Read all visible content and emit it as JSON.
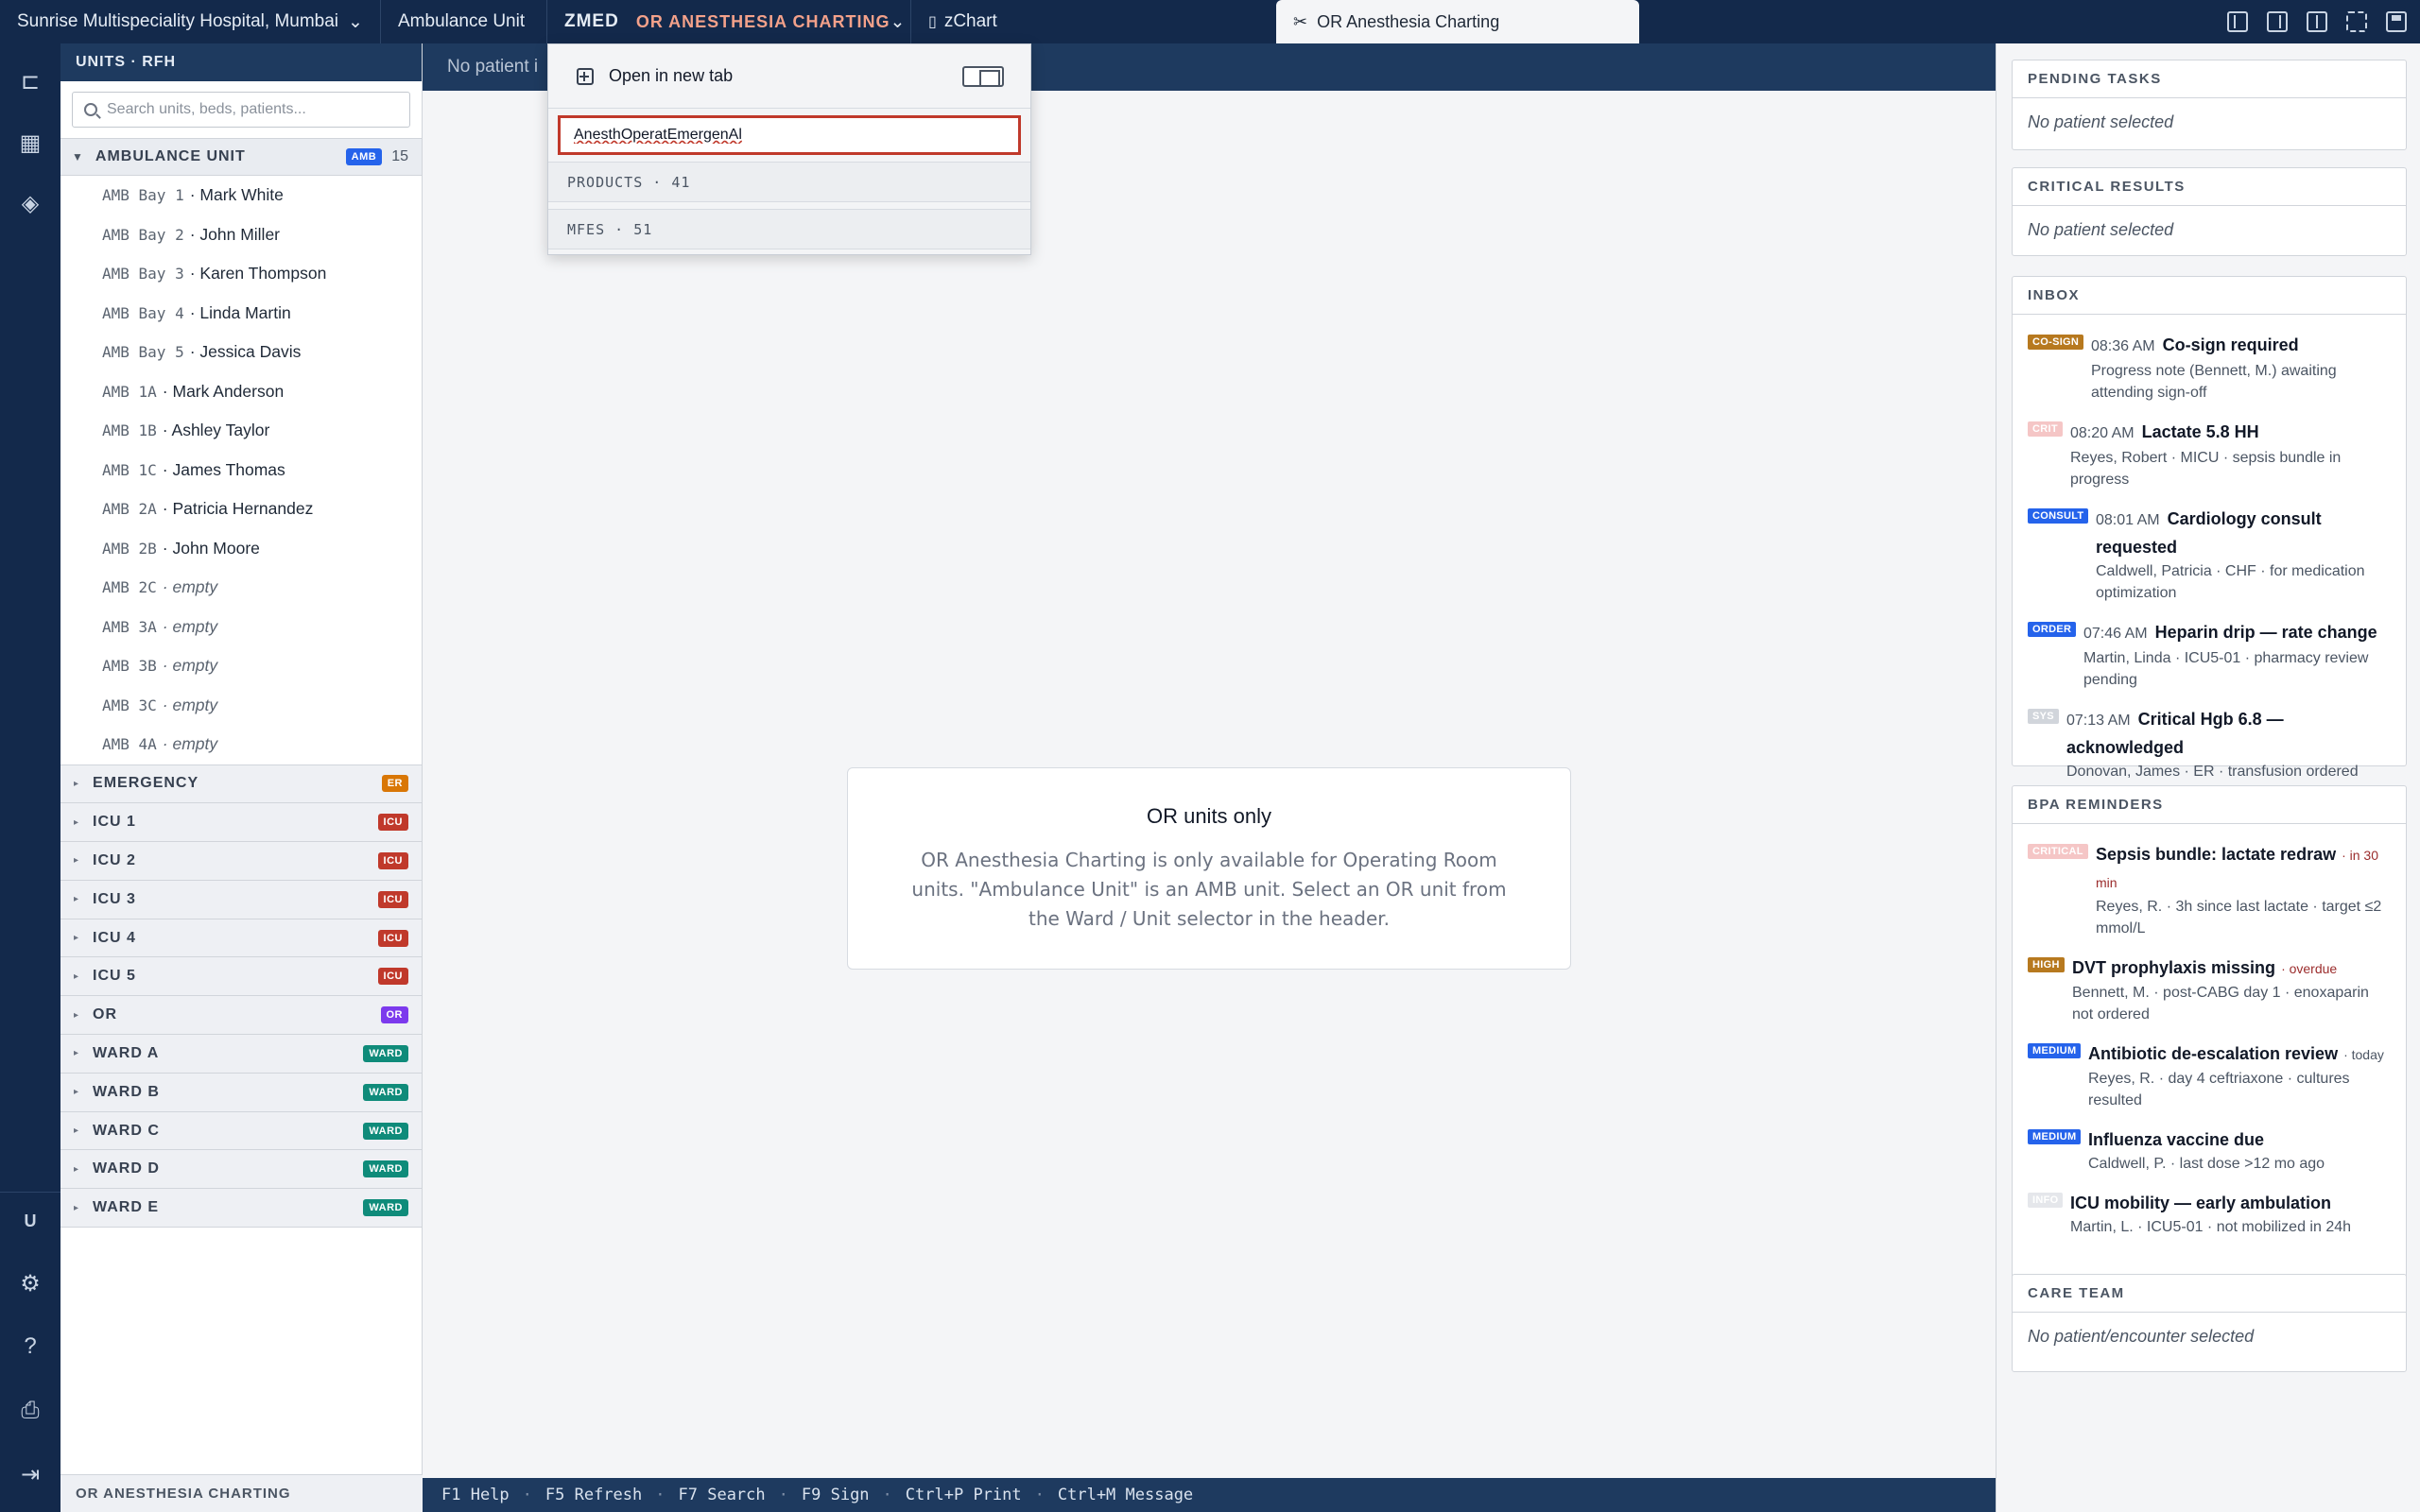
{
  "topbar": {
    "hospital": "Sunrise Multispeciality Hospital, Mumbai",
    "unit": "Ambulance Unit",
    "app_code": "ZMED",
    "activity": "OR ANESTHESIA CHARTING",
    "zchart": "zChart",
    "active_tab": "OR Anesthesia Charting"
  },
  "units_panel": {
    "header": "UNITS · RFH",
    "search_placeholder": "Search units, beds, patients...",
    "open_group": {
      "name": "AMBULANCE UNIT",
      "badge": "AMB",
      "count": "15"
    },
    "beds": [
      {
        "id": "AMB Bay 1",
        "patient": "· Mark White",
        "empty": false
      },
      {
        "id": "AMB Bay 2",
        "patient": "· John Miller",
        "empty": false
      },
      {
        "id": "AMB Bay 3",
        "patient": "· Karen Thompson",
        "empty": false
      },
      {
        "id": "AMB Bay 4",
        "patient": "· Linda Martin",
        "empty": false
      },
      {
        "id": "AMB Bay 5",
        "patient": "· Jessica Davis",
        "empty": false
      },
      {
        "id": "AMB 1A",
        "patient": "· Mark Anderson",
        "empty": false
      },
      {
        "id": "AMB 1B",
        "patient": "· Ashley Taylor",
        "empty": false
      },
      {
        "id": "AMB 1C",
        "patient": "· James Thomas",
        "empty": false
      },
      {
        "id": "AMB 2A",
        "patient": "· Patricia Hernandez",
        "empty": false
      },
      {
        "id": "AMB 2B",
        "patient": "· John Moore",
        "empty": false
      },
      {
        "id": "AMB 2C",
        "patient": "· empty",
        "empty": true
      },
      {
        "id": "AMB 3A",
        "patient": "· empty",
        "empty": true
      },
      {
        "id": "AMB 3B",
        "patient": "· empty",
        "empty": true
      },
      {
        "id": "AMB 3C",
        "patient": "· empty",
        "empty": true
      },
      {
        "id": "AMB 4A",
        "patient": "· empty",
        "empty": true
      }
    ],
    "groups": [
      {
        "name": "EMERGENCY",
        "badge": "ER",
        "color": "#d97706"
      },
      {
        "name": "ICU 1",
        "badge": "ICU",
        "color": "#c0392b"
      },
      {
        "name": "ICU 2",
        "badge": "ICU",
        "color": "#c0392b"
      },
      {
        "name": "ICU 3",
        "badge": "ICU",
        "color": "#c0392b"
      },
      {
        "name": "ICU 4",
        "badge": "ICU",
        "color": "#c0392b"
      },
      {
        "name": "ICU 5",
        "badge": "ICU",
        "color": "#c0392b"
      },
      {
        "name": "OR",
        "badge": "OR",
        "color": "#7c3aed"
      },
      {
        "name": "WARD A",
        "badge": "WARD",
        "color": "#0f8b7a"
      },
      {
        "name": "WARD B",
        "badge": "WARD",
        "color": "#0f8b7a"
      },
      {
        "name": "WARD C",
        "badge": "WARD",
        "color": "#0f8b7a"
      },
      {
        "name": "WARD D",
        "badge": "WARD",
        "color": "#0f8b7a"
      },
      {
        "name": "WARD E",
        "badge": "WARD",
        "color": "#0f8b7a"
      }
    ],
    "footer": "OR ANESTHESIA CHARTING"
  },
  "main": {
    "strip_text": "No patient i",
    "notice_title": "OR units only",
    "notice_message": "OR Anesthesia Charting is only available for Operating Room units. \"Ambulance Unit\" is an AMB unit. Select an OR unit from the Ward / Unit selector in the header."
  },
  "popup": {
    "open_new_tab": "Open in new tab",
    "search_value": "AnesthOperatEmergenAl",
    "products": "PRODUCTS · 41",
    "mfes": "MFES · 51"
  },
  "fkeys": [
    "F1 Help",
    "F5 Refresh",
    "F7 Search",
    "F9 Sign",
    "Ctrl+P Print",
    "Ctrl+M Message"
  ],
  "right": {
    "pending_tasks": {
      "title": "PENDING TASKS",
      "empty": "No patient selected"
    },
    "critical_results": {
      "title": "CRITICAL RESULTS",
      "empty": "No patient selected"
    },
    "inbox": {
      "title": "INBOX",
      "items": [
        {
          "tag": "CO-SIGN",
          "color": "#b7791f",
          "time": "08:36 AM",
          "title": "Co-sign required",
          "sub": "Progress note (Bennett, M.) awaiting attending sign-off"
        },
        {
          "tag": "CRIT",
          "color": "#f5c6c6",
          "time": "08:20 AM",
          "title": "Lactate 5.8 HH",
          "sub": "Reyes, Robert · MICU · sepsis bundle in progress"
        },
        {
          "tag": "CONSULT",
          "color": "#2563eb",
          "time": "08:01 AM",
          "title": "Cardiology consult requested",
          "sub": "Caldwell, Patricia · CHF · for medication optimization"
        },
        {
          "tag": "ORDER",
          "color": "#2563eb",
          "time": "07:46 AM",
          "title": "Heparin drip — rate change",
          "sub": "Martin, Linda · ICU5-01 · pharmacy review pending"
        },
        {
          "tag": "SYS",
          "color": "#d1d5db",
          "time": "07:13 AM",
          "title": "Critical Hgb 6.8 — acknowledged",
          "sub": "Donovan, James · ER · transfusion ordered"
        }
      ]
    },
    "bpa": {
      "title": "BPA REMINDERS",
      "items": [
        {
          "tag": "CRITICAL",
          "color": "#f5c6c6",
          "title": "Sepsis bundle: lactate redraw",
          "suffix": "· in 30 min",
          "alert": true,
          "sub": "Reyes, R. · 3h since last lactate · target ≤2 mmol/L"
        },
        {
          "tag": "HIGH",
          "color": "#b7791f",
          "title": "DVT prophylaxis missing",
          "suffix": "· overdue",
          "alert": true,
          "sub": "Bennett, M. · post-CABG day 1 · enoxaparin not ordered"
        },
        {
          "tag": "MEDIUM",
          "color": "#2563eb",
          "title": "Antibiotic de-escalation review",
          "suffix": "· today",
          "alert": false,
          "sub": "Reyes, R. · day 4 ceftriaxone · cultures resulted"
        },
        {
          "tag": "MEDIUM",
          "color": "#2563eb",
          "title": "Influenza vaccine due",
          "suffix": "",
          "alert": false,
          "sub": "Caldwell, P. · last dose >12 mo ago"
        },
        {
          "tag": "INFO",
          "color": "#e5e7eb",
          "title": "ICU mobility — early ambulation",
          "suffix": "",
          "alert": false,
          "sub": "Martin, L. · ICU5-01 · not mobilized in 24h"
        }
      ]
    },
    "care_team": {
      "title": "CARE TEAM",
      "empty": "No patient/encounter selected"
    }
  },
  "rail": {
    "user_initial": "U"
  },
  "colors": {
    "navy": "#13294b",
    "navy_mid": "#1e3a5f",
    "accent_orange": "#f3a18a",
    "error_red": "#c0392b",
    "amb_badge": "#2563eb"
  }
}
